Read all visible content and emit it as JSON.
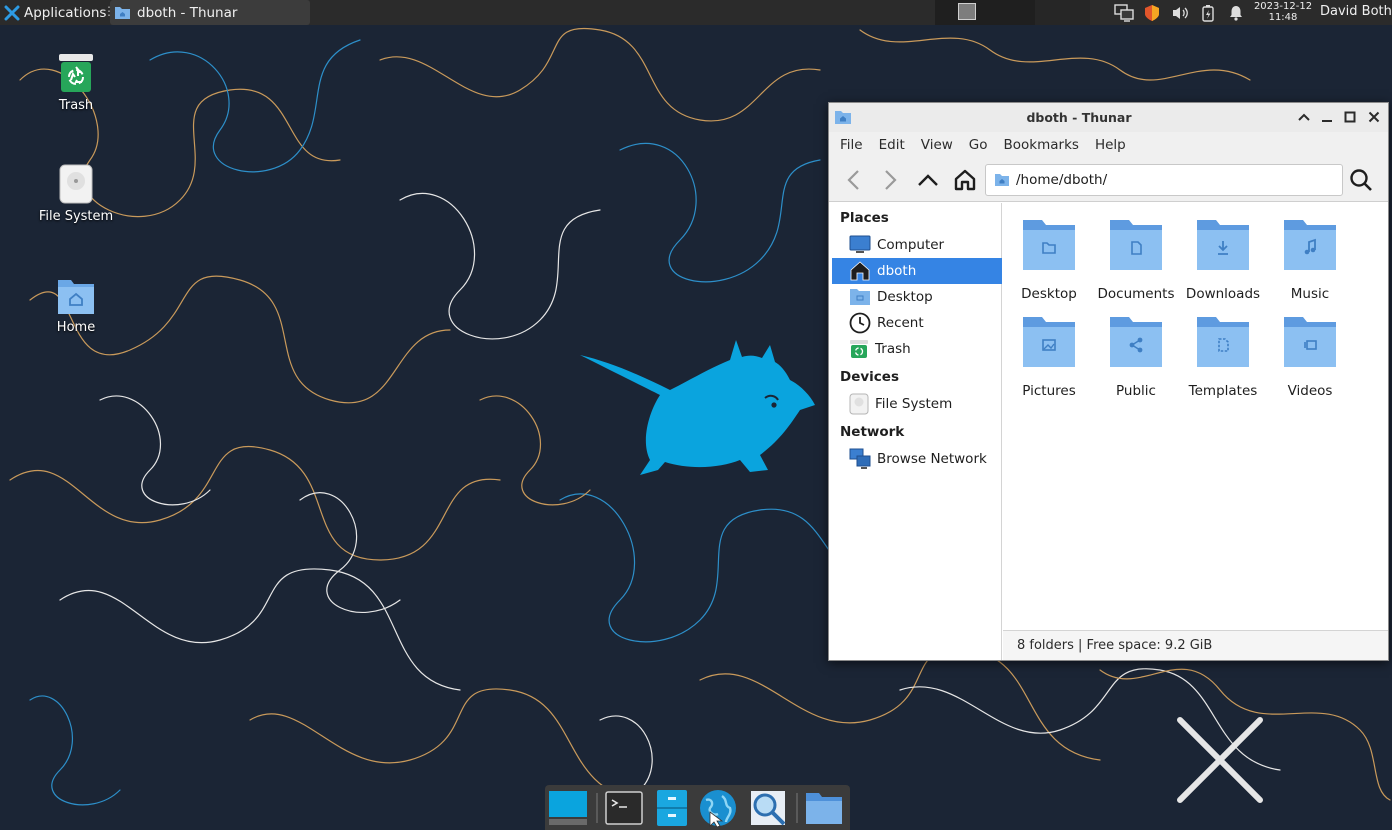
{
  "panel": {
    "apps_label": "Applications",
    "task_title": "dboth - Thunar",
    "clock_date": "2023-12-12",
    "clock_time": "11:48",
    "user": "David Both"
  },
  "desktop": {
    "icons": [
      {
        "label": "Trash",
        "icon": "trash-icon"
      },
      {
        "label": "File System",
        "icon": "drive-icon"
      },
      {
        "label": "Home",
        "icon": "home-folder-icon"
      }
    ]
  },
  "window": {
    "title": "dboth - Thunar",
    "menu": [
      "File",
      "Edit",
      "View",
      "Go",
      "Bookmarks",
      "Help"
    ],
    "location": "/home/dboth/",
    "sidebar": {
      "places_heading": "Places",
      "places": [
        "Computer",
        "dboth",
        "Desktop",
        "Recent",
        "Trash"
      ],
      "devices_heading": "Devices",
      "devices": [
        "File System"
      ],
      "network_heading": "Network",
      "network": [
        "Browse Network"
      ],
      "selected": "dboth"
    },
    "files": [
      {
        "name": "Desktop",
        "icon": "folder-desktop-icon"
      },
      {
        "name": "Documents",
        "icon": "folder-documents-icon"
      },
      {
        "name": "Downloads",
        "icon": "folder-downloads-icon"
      },
      {
        "name": "Music",
        "icon": "folder-music-icon"
      },
      {
        "name": "Pictures",
        "icon": "folder-pictures-icon"
      },
      {
        "name": "Public",
        "icon": "folder-public-icon"
      },
      {
        "name": "Templates",
        "icon": "folder-templates-icon"
      },
      {
        "name": "Videos",
        "icon": "folder-videos-icon"
      }
    ],
    "status": "8 folders  |  Free space: 9.2 GiB"
  },
  "colors": {
    "desktop_bg": "#1b2535",
    "selection": "#3584e4",
    "folder": "#7cb3ea",
    "mascot": "#0aa4de"
  }
}
